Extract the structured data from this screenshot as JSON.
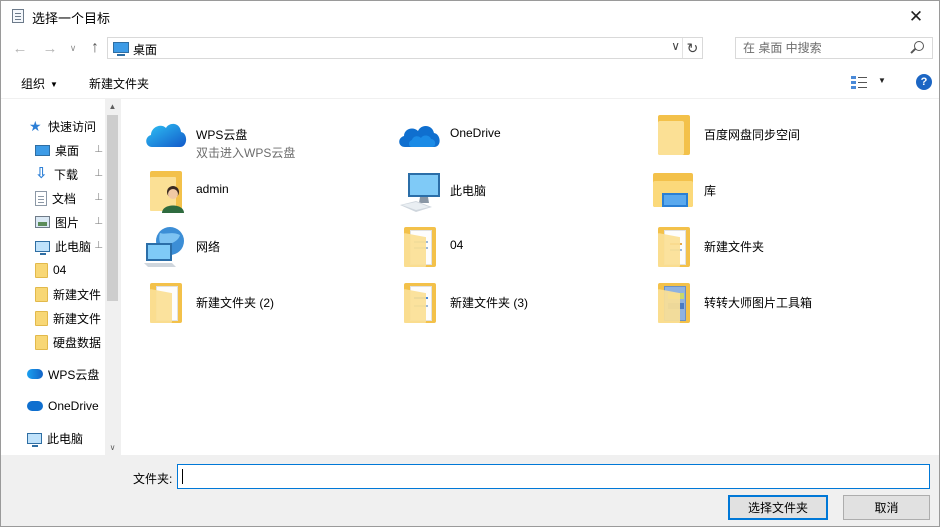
{
  "window": {
    "title": "选择一个目标",
    "close_glyph": "✕"
  },
  "nav": {
    "back_glyph": "←",
    "forward_glyph": "→",
    "recent_glyph": "∨",
    "up_glyph": "↑",
    "address_crumb": "桌面",
    "address_dropdown_glyph": "∨",
    "refresh_glyph": "↻",
    "search_placeholder": "在 桌面 中搜索"
  },
  "toolbar": {
    "organize_label": "组织",
    "organize_caret": "▼",
    "new_folder_label": "新建文件夹",
    "view_caret": "▼",
    "help_glyph": "?"
  },
  "sidebar": {
    "items": [
      {
        "label": "快速访问",
        "icon": "star-icon"
      },
      {
        "label": "桌面",
        "icon": "desktop-icon",
        "pinned": true
      },
      {
        "label": "下载",
        "icon": "download-icon",
        "pinned": true
      },
      {
        "label": "文档",
        "icon": "document-icon",
        "pinned": true
      },
      {
        "label": "图片",
        "icon": "pictures-icon",
        "pinned": true
      },
      {
        "label": "此电脑",
        "icon": "computer-icon",
        "pinned": true
      },
      {
        "label": "04",
        "icon": "folder-icon"
      },
      {
        "label": "新建文件",
        "icon": "folder-icon"
      },
      {
        "label": "新建文件",
        "icon": "folder-icon"
      },
      {
        "label": "硬盘数据",
        "icon": "folder-icon"
      },
      {
        "label": "WPS云盘",
        "icon": "wps-cloud-icon"
      },
      {
        "label": "OneDrive",
        "icon": "onedrive-icon"
      },
      {
        "label": "此电脑",
        "icon": "computer-icon"
      }
    ],
    "pin_glyph": "📌",
    "scroll_up_glyph": "▲",
    "scroll_down_glyph": "∨"
  },
  "content": {
    "items": [
      {
        "name": "WPS云盘",
        "sub": "双击进入WPS云盘",
        "icon": "wps-cloud-icon"
      },
      {
        "name": "OneDrive",
        "icon": "onedrive-icon"
      },
      {
        "name": "百度网盘同步空间",
        "icon": "folder-icon"
      },
      {
        "name": "admin",
        "icon": "user-folder-icon"
      },
      {
        "name": "此电脑",
        "icon": "computer-icon"
      },
      {
        "name": "库",
        "icon": "library-icon"
      },
      {
        "name": "网络",
        "icon": "network-icon"
      },
      {
        "name": "04",
        "icon": "folder-icon"
      },
      {
        "name": "新建文件夹",
        "icon": "folder-icon"
      },
      {
        "name": "新建文件夹 (2)",
        "icon": "folder-icon"
      },
      {
        "name": "新建文件夹 (3)",
        "icon": "folder-icon"
      },
      {
        "name": "转转大师图片工具箱",
        "icon": "folder-icon"
      }
    ]
  },
  "footer": {
    "folder_label": "文件夹:",
    "folder_value": "",
    "select_button": "选择文件夹",
    "cancel_button": "取消"
  },
  "colors": {
    "accent": "#0078d7",
    "folder_yellow": "#f3c14a",
    "footer_bg": "#f0f0f0"
  }
}
